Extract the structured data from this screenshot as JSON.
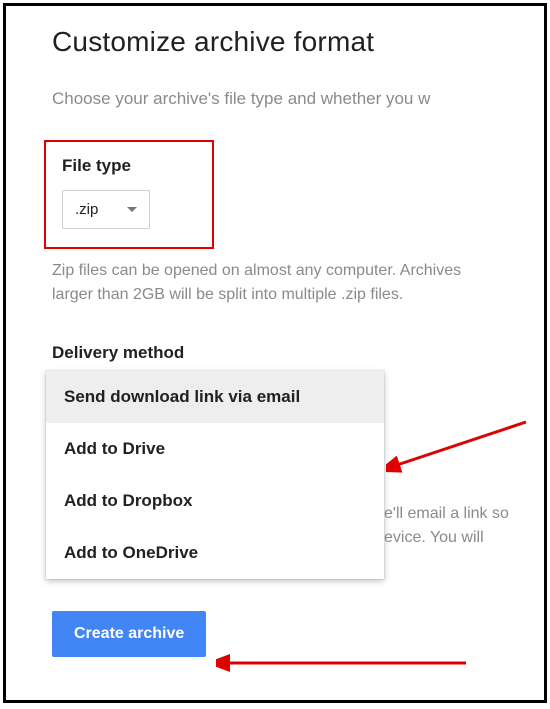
{
  "title": "Customize archive format",
  "description": "Choose your archive's file type and whether you w",
  "file_type": {
    "label": "File type",
    "value": ".zip",
    "hint": "Zip files can be opened on almost any computer. Archives larger than 2GB will be split into multiple .zip files."
  },
  "delivery": {
    "label": "Delivery method",
    "options": [
      "Send download link via email",
      "Add to Drive",
      "Add to Dropbox",
      "Add to OneDrive"
    ],
    "behind_line1": "e'll email a link so",
    "behind_line2": "evice. You will"
  },
  "button": {
    "create": "Create archive"
  }
}
